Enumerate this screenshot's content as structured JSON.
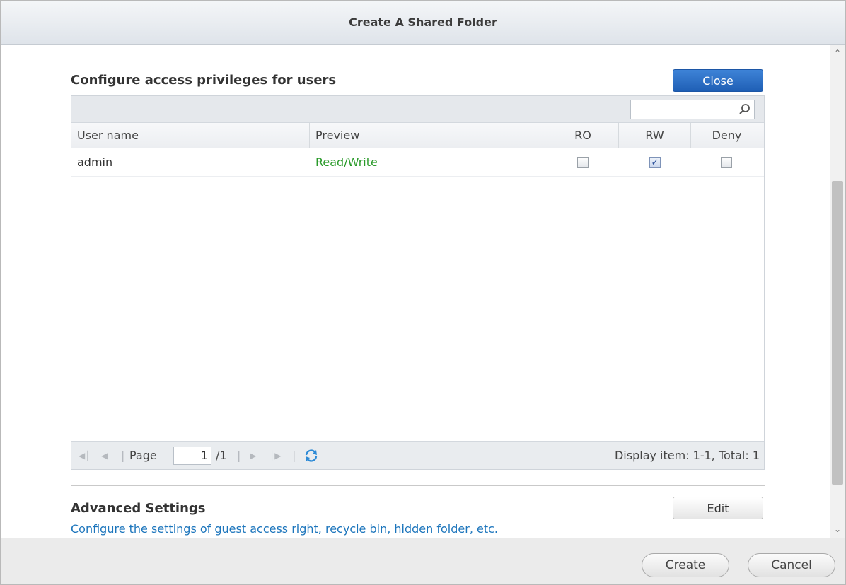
{
  "dialog": {
    "title": "Create A Shared Folder"
  },
  "privileges": {
    "title": "Configure access privileges for users",
    "close_label": "Close",
    "search": {
      "value": "",
      "placeholder": ""
    },
    "columns": [
      "User name",
      "Preview",
      "RO",
      "RW",
      "Deny"
    ],
    "rows": [
      {
        "user": "admin",
        "preview": "Read/Write",
        "ro": false,
        "rw": true,
        "deny": false
      }
    ],
    "pager": {
      "page_label": "Page",
      "page_value": "1",
      "page_total": "/1",
      "display_info": "Display item: 1-1, Total: 1"
    }
  },
  "advanced": {
    "title": "Advanced Settings",
    "edit_label": "Edit",
    "description": "Configure the settings of guest access right, recycle bin, hidden folder, etc."
  },
  "footer": {
    "create_label": "Create",
    "cancel_label": "Cancel"
  },
  "icons": {
    "search": "search-icon",
    "refresh": "refresh-icon",
    "first": "first-page-icon",
    "prev": "prev-page-icon",
    "next": "next-page-icon",
    "last": "last-page-icon",
    "scroll_up": "chevron-up-icon",
    "scroll_down": "chevron-down-icon"
  },
  "colors": {
    "accent": "#2a6cc4",
    "preview_green": "#2a9a2a",
    "link_blue": "#1c75bc"
  }
}
